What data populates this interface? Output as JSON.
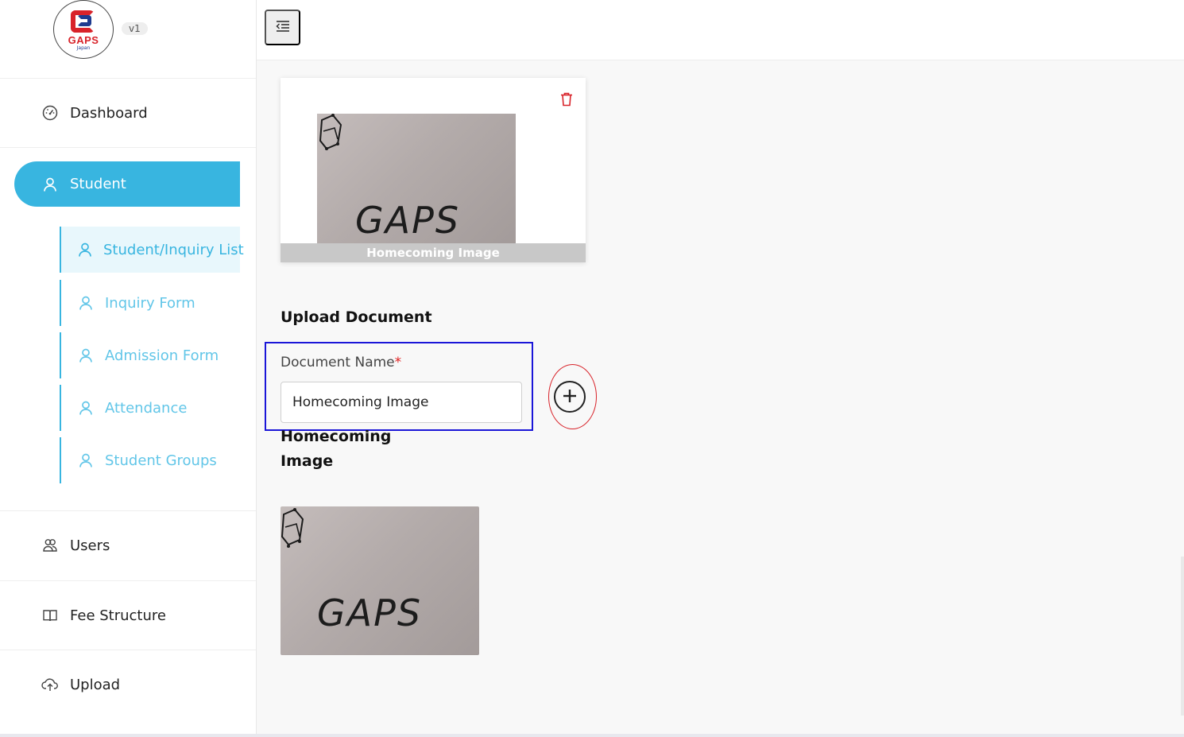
{
  "brand": {
    "name": "GAPS",
    "subtitle": "Japan",
    "version": "v1"
  },
  "sidebar": {
    "dashboard": {
      "label": "Dashboard",
      "icon": "dashboard-gauge-icon"
    },
    "student": {
      "label": "Student",
      "icon": "user-icon"
    },
    "student_sub": [
      {
        "label": "Student/Inquiry List",
        "icon": "user-icon",
        "active": true
      },
      {
        "label": "Inquiry Form",
        "icon": "user-icon"
      },
      {
        "label": "Admission Form",
        "icon": "user-icon"
      },
      {
        "label": "Attendance",
        "icon": "user-icon"
      },
      {
        "label": "Student Groups",
        "icon": "user-icon"
      }
    ],
    "lower": [
      {
        "label": "Users",
        "icon": "users-icon"
      },
      {
        "label": "Fee Structure",
        "icon": "book-icon"
      },
      {
        "label": "Upload",
        "icon": "cloud-upload-icon"
      }
    ]
  },
  "topbar": {
    "menu_toggle_icon": "menu-collapse-icon"
  },
  "main": {
    "uploaded_card": {
      "caption": "Homecoming Image",
      "delete_icon": "trash-icon"
    },
    "upload_section": {
      "title": "Upload Document",
      "field_label": "Document Name",
      "required_mark": "*",
      "field_value": "Homecoming Image",
      "add_icon": "plus-circle-icon"
    },
    "document_name": "Homecoming Image",
    "photo_text": "GAPS"
  },
  "colors": {
    "accent": "#38b5e0",
    "highlight_box": "#1a16d8",
    "annotation_circle": "#d8232a",
    "delete": "#d8232a"
  }
}
